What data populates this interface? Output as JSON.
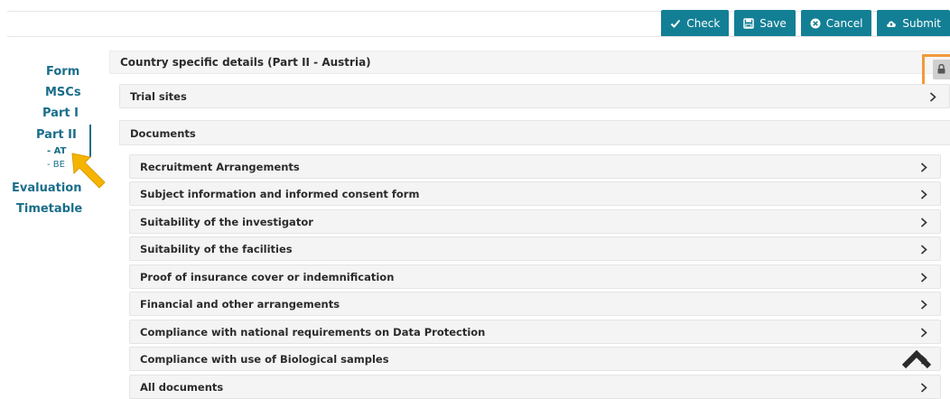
{
  "toolbar": {
    "check": "Check",
    "save": "Save",
    "cancel": "Cancel",
    "submit": "Submit"
  },
  "sidebar": {
    "items": [
      {
        "label": "Form"
      },
      {
        "label": "MSCs"
      },
      {
        "label": "Part I"
      },
      {
        "label": "Part II"
      }
    ],
    "subitems": [
      {
        "label": "- AT"
      },
      {
        "label": "- BE"
      }
    ],
    "evaluation": "Evaluation",
    "timetable": "Timetable"
  },
  "header": {
    "title": "Country specific details (Part II - Austria)"
  },
  "trial_sites": "Trial sites",
  "documents": {
    "title": "Documents",
    "items": [
      "Recruitment Arrangements",
      "Subject information and informed consent form",
      "Suitability of the investigator",
      "Suitability of the facilities",
      "Proof of insurance cover or indemnification",
      "Financial and other arrangements",
      "Compliance with national requirements on Data Protection",
      "Compliance with use of Biological samples",
      "All documents"
    ]
  },
  "colors": {
    "accent": "#137f95",
    "nav_text": "#1a6e8a",
    "highlight": "#f29a3a",
    "cursor": "#f5b400"
  }
}
